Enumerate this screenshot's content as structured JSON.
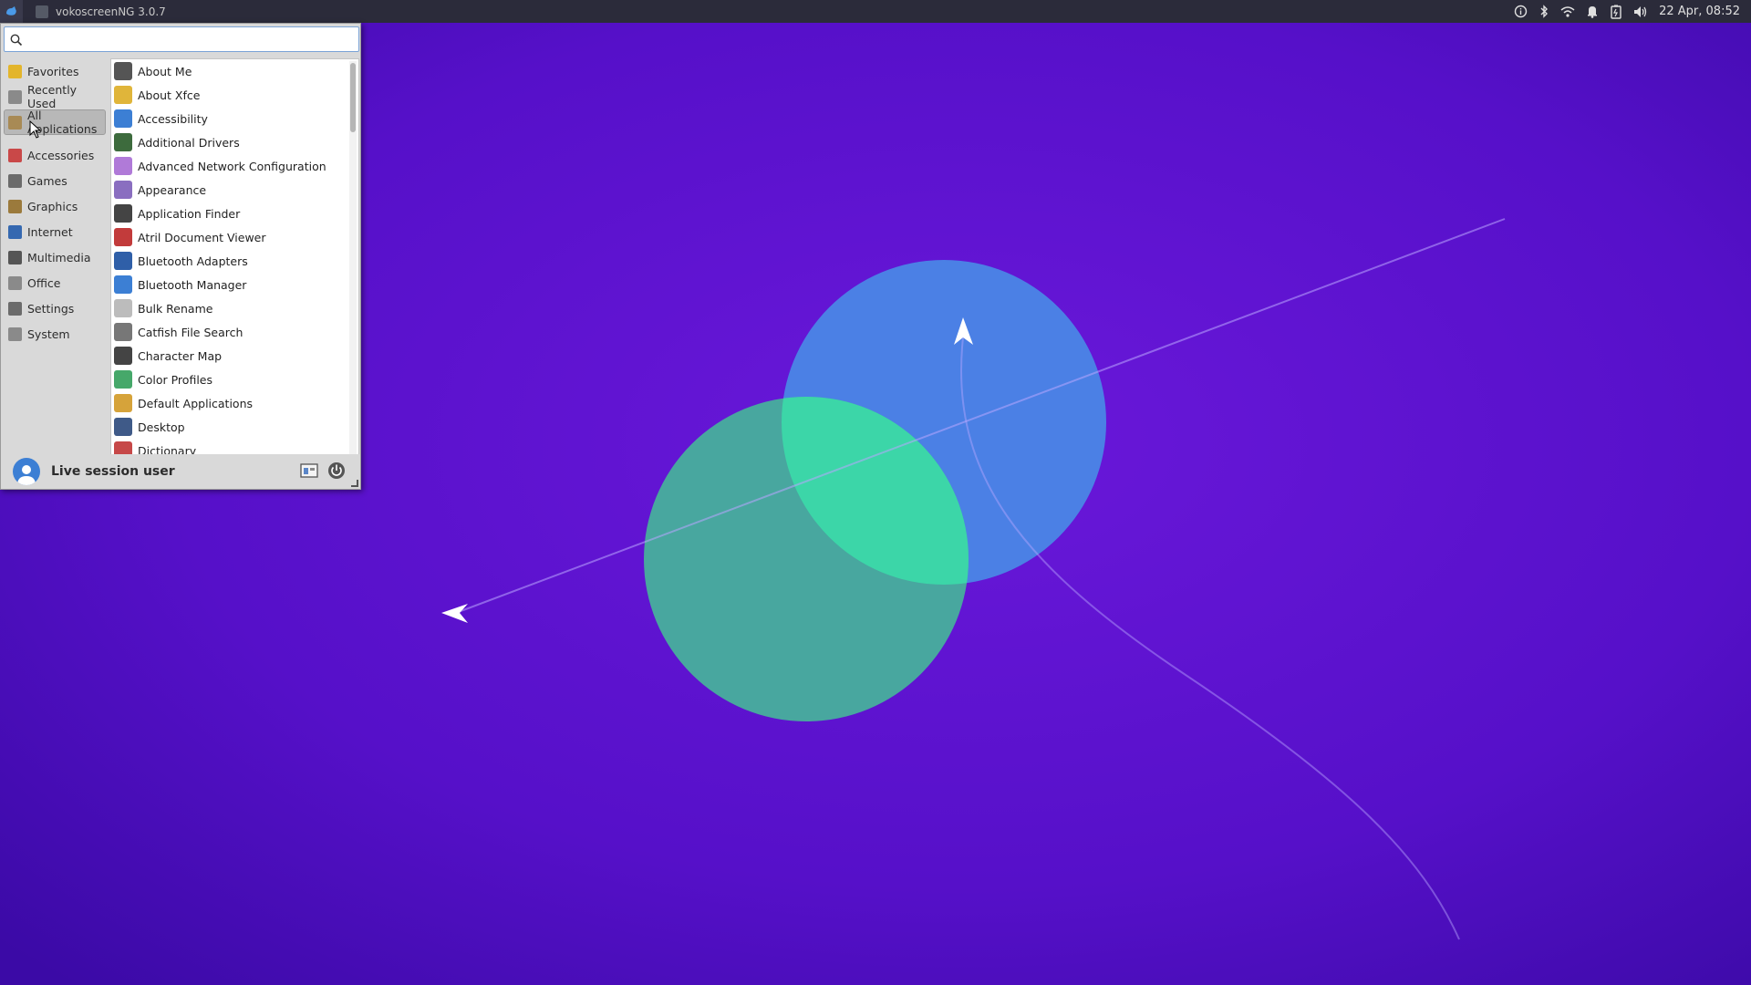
{
  "taskbar": {
    "task_title": "vokoscreenNG 3.0.7",
    "clock": "22 Apr, 08:52",
    "tray_icons": [
      "info-icon",
      "bluetooth-icon",
      "wifi-icon",
      "bell-icon",
      "battery-icon",
      "volume-icon"
    ]
  },
  "menu": {
    "search_placeholder": "",
    "categories": [
      {
        "label": "Favorites",
        "icon": "star-icon",
        "color": "#e3b52c"
      },
      {
        "label": "Recently Used",
        "icon": "clock-icon",
        "color": "#8a8a8a"
      },
      {
        "label": "All Applications",
        "icon": "grid-icon",
        "color": "#a88a55",
        "selected": true
      },
      {
        "label": "Accessories",
        "icon": "accessories-icon",
        "color": "#c94848"
      },
      {
        "label": "Games",
        "icon": "gamepad-icon",
        "color": "#6b6b6b"
      },
      {
        "label": "Graphics",
        "icon": "palette-icon",
        "color": "#9b7a3c"
      },
      {
        "label": "Internet",
        "icon": "globe-icon",
        "color": "#3568b0"
      },
      {
        "label": "Multimedia",
        "icon": "media-icon",
        "color": "#555"
      },
      {
        "label": "Office",
        "icon": "office-icon",
        "color": "#8a8a8a"
      },
      {
        "label": "Settings",
        "icon": "settings-icon",
        "color": "#6b6b6b"
      },
      {
        "label": "System",
        "icon": "gear-icon",
        "color": "#8a8a8a"
      }
    ],
    "apps": [
      {
        "label": "About Me",
        "icon": "user-icon",
        "color": "#555"
      },
      {
        "label": "About Xfce",
        "icon": "star-icon",
        "color": "#e0b53a"
      },
      {
        "label": "Accessibility",
        "icon": "accessibility-icon",
        "color": "#3c7fd4"
      },
      {
        "label": "Additional Drivers",
        "icon": "chip-icon",
        "color": "#3d6b3d"
      },
      {
        "label": "Advanced Network Configuration",
        "icon": "network-icon",
        "color": "#b07ad8"
      },
      {
        "label": "Appearance",
        "icon": "brush-icon",
        "color": "#8a6ec0"
      },
      {
        "label": "Application Finder",
        "icon": "magnifier-icon",
        "color": "#444"
      },
      {
        "label": "Atril Document Viewer",
        "icon": "document-viewer-icon",
        "color": "#c23b3b"
      },
      {
        "label": "Bluetooth Adapters",
        "icon": "bluetooth-adapter-icon",
        "color": "#2f5fa8"
      },
      {
        "label": "Bluetooth Manager",
        "icon": "bluetooth-icon",
        "color": "#3c7fd4"
      },
      {
        "label": "Bulk Rename",
        "icon": "rename-icon",
        "color": "#bcbcbc"
      },
      {
        "label": "Catfish File Search",
        "icon": "file-search-icon",
        "color": "#777"
      },
      {
        "label": "Character Map",
        "icon": "character-map-icon",
        "color": "#444"
      },
      {
        "label": "Color Profiles",
        "icon": "color-profile-icon",
        "color": "#46a86a"
      },
      {
        "label": "Default Applications",
        "icon": "default-apps-icon",
        "color": "#d6a33a"
      },
      {
        "label": "Desktop",
        "icon": "desktop-icon",
        "color": "#3f5a88"
      },
      {
        "label": "Dictionary",
        "icon": "dictionary-icon",
        "color": "#c64848"
      }
    ],
    "user_name": "Live session user",
    "footer_buttons": [
      "settings-manager-icon",
      "power-icon"
    ]
  },
  "colors": {
    "wallpaper": "#5a12cf",
    "circle_blue": "#4a8be8",
    "circle_green": "#4aa8a0",
    "overlap": "#3ad4a8"
  }
}
